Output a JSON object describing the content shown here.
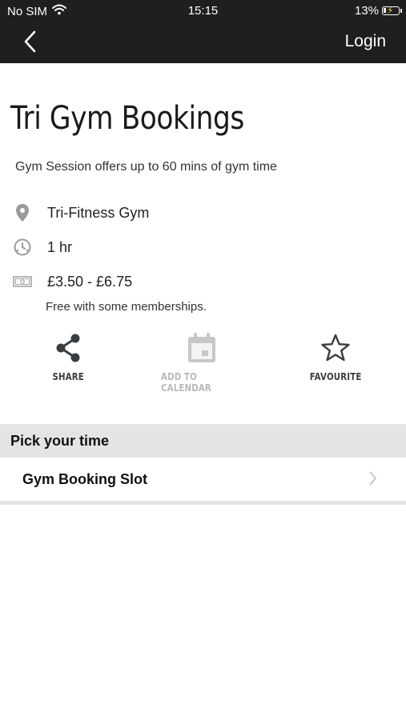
{
  "status_bar": {
    "carrier": "No SIM",
    "time": "15:15",
    "battery": "13%",
    "battery_level": 0.13
  },
  "nav": {
    "back_icon": "chevron-left-icon",
    "login_label": "Login"
  },
  "page": {
    "title": "Tri Gym Bookings",
    "description": "Gym Session offers up to 60 mins of gym time"
  },
  "info": {
    "venue": "Tri-Fitness Gym",
    "duration": "1 hr",
    "price": "£3.50 - £6.75",
    "note": "Free with some memberships."
  },
  "actions": {
    "share": "SHARE",
    "calendar": "ADD TO CALENDAR",
    "favourite": "FAVOURITE"
  },
  "times": {
    "header": "Pick your time",
    "slots": [
      {
        "label": "Gym Booking Slot"
      }
    ]
  },
  "colors": {
    "topbar": "#1f1f1f",
    "section_background": "#e4e4e4",
    "action_active": "#3a3d40",
    "action_disabled": "#b9b9b9"
  }
}
